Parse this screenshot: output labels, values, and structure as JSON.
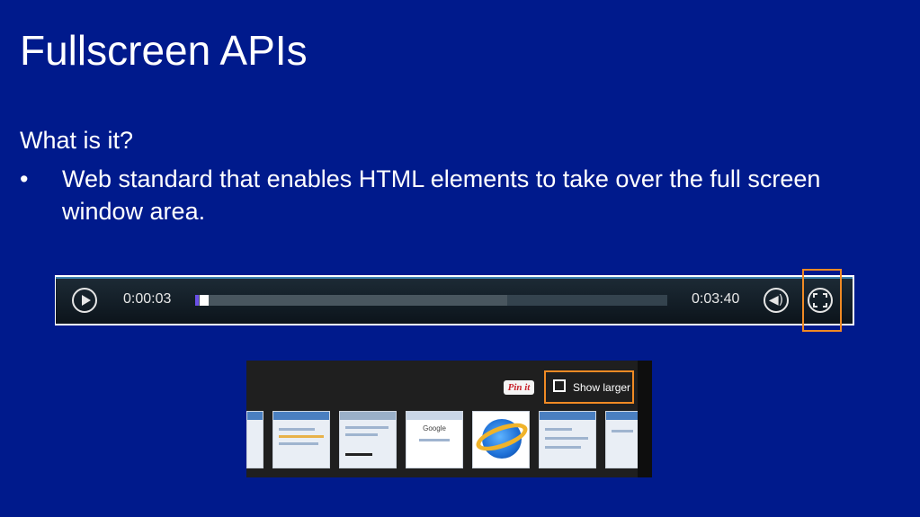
{
  "slide": {
    "title": "Fullscreen APIs",
    "subheading": "What is it?",
    "bullet_marker": "•",
    "bullet_text": "Web standard that enables HTML elements to take over the full screen window area."
  },
  "player": {
    "current_time": "0:00:03",
    "total_time": "0:03:40",
    "progress": 0.01,
    "buffered": 0.66,
    "icons": [
      "play-icon",
      "volume-icon",
      "fullscreen-icon"
    ],
    "highlight_color": "#f08a24"
  },
  "image_strip": {
    "pin_label": "Pin it",
    "show_larger_label": "Show larger",
    "google_label": "Google",
    "thumbnails": [
      "partial-thumb",
      "window-thumb",
      "page-thumb",
      "google-thumb",
      "ie-logo-thumb",
      "doc-thumb",
      "partial-thumb"
    ]
  },
  "colors": {
    "background": "#001a8c",
    "accent": "#f08a24"
  }
}
